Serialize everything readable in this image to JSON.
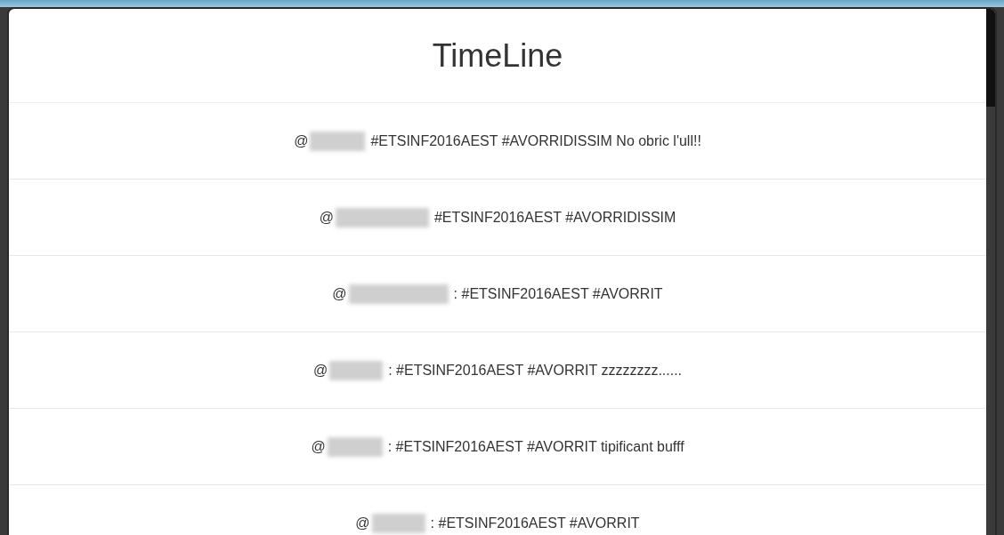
{
  "title": "TimeLine",
  "tweets": [
    {
      "at": "@",
      "text": "#ETSINF2016AEST #AVORRIDISSIM No obric l'ull!!"
    },
    {
      "at": "@",
      "text": "#ETSINF2016AEST #AVORRIDISSIM"
    },
    {
      "at": "@",
      "text": ": #ETSINF2016AEST #AVORRIT"
    },
    {
      "at": "@",
      "text": ": #ETSINF2016AEST #AVORRIT zzzzzzzz......"
    },
    {
      "at": "@",
      "text": ": #ETSINF2016AEST #AVORRIT tipificant bufff"
    },
    {
      "at": "@",
      "text": ": #ETSINF2016AEST #AVORRIT"
    }
  ]
}
